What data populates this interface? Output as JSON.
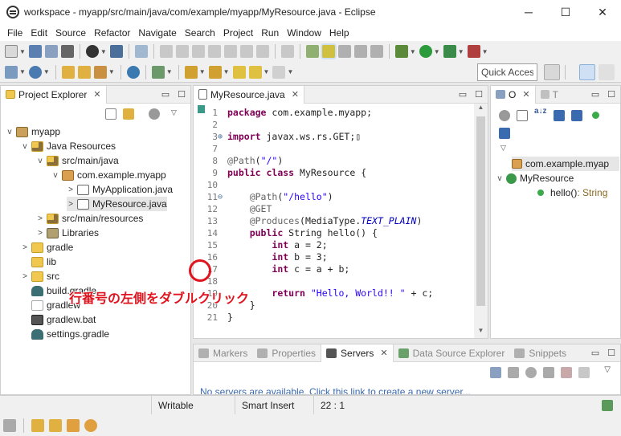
{
  "window": {
    "title": "workspace - myapp/src/main/java/com/example/myapp/MyResource.java - Eclipse",
    "minimize": "─",
    "maximize": "☐",
    "close": "✕"
  },
  "menu": [
    "File",
    "Edit",
    "Source",
    "Refactor",
    "Navigate",
    "Search",
    "Project",
    "Run",
    "Window",
    "Help"
  ],
  "toolbar": {
    "quick_access": "Quick Access"
  },
  "project_explorer": {
    "tab_label": "Project Explorer",
    "close": "✕",
    "tree": [
      {
        "label": "myapp",
        "depth": 0,
        "twisty": "v",
        "icon": "project-icon"
      },
      {
        "label": "Java Resources",
        "depth": 1,
        "twisty": "v",
        "icon": "java-resources-icon"
      },
      {
        "label": "src/main/java",
        "depth": 2,
        "twisty": "v",
        "icon": "source-folder-icon"
      },
      {
        "label": "com.example.myapp",
        "depth": 3,
        "twisty": "v",
        "icon": "package-icon"
      },
      {
        "label": "MyApplication.java",
        "depth": 4,
        "twisty": ">",
        "icon": "java-file-icon"
      },
      {
        "label": "MyResource.java",
        "depth": 4,
        "twisty": ">",
        "icon": "java-file-icon",
        "selected": true
      },
      {
        "label": "src/main/resources",
        "depth": 2,
        "twisty": ">",
        "icon": "source-folder-icon"
      },
      {
        "label": "Libraries",
        "depth": 2,
        "twisty": ">",
        "icon": "libraries-icon"
      },
      {
        "label": "gradle",
        "depth": 1,
        "twisty": ">",
        "icon": "folder-icon"
      },
      {
        "label": "lib",
        "depth": 1,
        "twisty": "",
        "icon": "folder-icon"
      },
      {
        "label": "src",
        "depth": 1,
        "twisty": ">",
        "icon": "folder-icon"
      },
      {
        "label": "build.gradle",
        "depth": 1,
        "twisty": "",
        "icon": "gradle-file-icon"
      },
      {
        "label": "gradlew",
        "depth": 1,
        "twisty": "",
        "icon": "file-icon"
      },
      {
        "label": "gradlew.bat",
        "depth": 1,
        "twisty": "",
        "icon": "bat-file-icon"
      },
      {
        "label": "settings.gradle",
        "depth": 1,
        "twisty": "",
        "icon": "gradle-file-icon"
      }
    ]
  },
  "editor": {
    "tab_label": "MyResource.java",
    "close": "✕",
    "lines": [
      {
        "num": "1",
        "text": "package com.example.myapp;"
      },
      {
        "num": "2",
        "text": ""
      },
      {
        "num": "3",
        "text": "import javax.ws.rs.GET;▯",
        "fold": "⊕"
      },
      {
        "num": "7",
        "text": ""
      },
      {
        "num": "8",
        "text": "@Path(\"/\")"
      },
      {
        "num": "9",
        "text": "public class MyResource {"
      },
      {
        "num": "10",
        "text": ""
      },
      {
        "num": "11",
        "text": "    @Path(\"/hello\")",
        "fold": "⊖"
      },
      {
        "num": "12",
        "text": "    @GET"
      },
      {
        "num": "13",
        "text": "    @Produces(MediaType.TEXT_PLAIN)"
      },
      {
        "num": "14",
        "text": "    public String hello() {"
      },
      {
        "num": "15",
        "text": "        int a = 2;"
      },
      {
        "num": "16",
        "text": "        int b = 3;"
      },
      {
        "num": "17",
        "text": "        int c = a + b;"
      },
      {
        "num": "18",
        "text": ""
      },
      {
        "num": "19",
        "text": "        return \"Hello, World!! \" + c;"
      },
      {
        "num": "20",
        "text": "    }"
      },
      {
        "num": "21",
        "text": "}"
      }
    ]
  },
  "outline": {
    "tab_label": "O",
    "tab2_label": "T",
    "tree": [
      {
        "label": "com.example.myap",
        "selected": true
      },
      {
        "label": "MyResource"
      },
      {
        "label": "hello()",
        "type": " : String"
      }
    ]
  },
  "bottom_tabs": [
    {
      "label": "Markers"
    },
    {
      "label": "Properties"
    },
    {
      "label": "Servers",
      "active": true
    },
    {
      "label": "Data Source Explorer"
    },
    {
      "label": "Snippets"
    }
  ],
  "servers_message": "No servers are available. Click this link to create a new server...",
  "status": {
    "mode": "Writable",
    "insert": "Smart Insert",
    "position": "22 : 1"
  },
  "annotation": "行番号の左側をダブルクリック",
  "colors": {
    "keyword": "#7f0055",
    "annotation_red": "#e0141e",
    "string": "#2a00ff"
  }
}
